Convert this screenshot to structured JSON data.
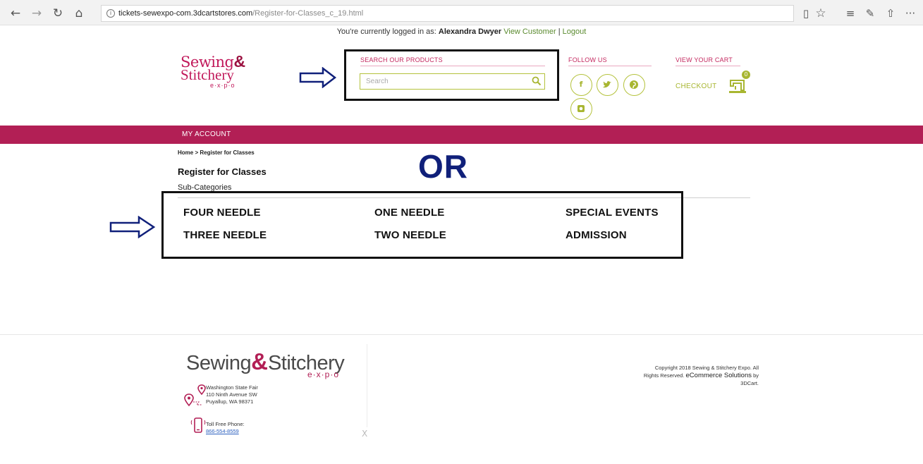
{
  "browser": {
    "url_domain": "tickets-sewexpo-com.3dcartstores.com",
    "url_path": "/Register-for-Classes_c_19.html",
    "info_symbol": "i",
    "back_glyph": "←",
    "forward_glyph": "→",
    "refresh_glyph": "↻",
    "home_glyph": "⌂",
    "reading_glyph": "▯",
    "favorite_glyph": "☆",
    "hub_glyph": "≡",
    "notes_glyph": "✎",
    "share_glyph": "⇧",
    "more_glyph": "···"
  },
  "login_bar": {
    "prefix": "You're currently logged in as:",
    "user": "Alexandra Dwyer",
    "view_customer": "View Customer",
    "separator": "|",
    "logout": "Logout"
  },
  "logo": {
    "line1": "Sewing",
    "amp": "&",
    "line2": "Stitchery",
    "line3": "e·x·p·o"
  },
  "search": {
    "label": "SEARCH OUR PRODUCTS",
    "placeholder": "Search"
  },
  "follow": {
    "label": "FOLLOW US",
    "facebook": "f",
    "twitter": "t"
  },
  "cart": {
    "label": "VIEW YOUR CART",
    "checkout": "CHECKOUT",
    "count": "0"
  },
  "nav": {
    "my_account": "MY ACCOUNT"
  },
  "main": {
    "breadcrumb_home": "Home",
    "breadcrumb_sep": ">",
    "breadcrumb_current": "Register for Classes",
    "title": "Register for Classes",
    "subcategories_label": "Sub-Categories",
    "or_text": "OR",
    "categories": [
      "FOUR NEEDLE",
      "ONE NEEDLE",
      "SPECIAL EVENTS",
      "THREE NEEDLE",
      "TWO NEEDLE",
      "ADMISSION"
    ]
  },
  "footer": {
    "logo_main1": "Sewing",
    "logo_amp": "&",
    "logo_main2": "Stitchery",
    "logo_sub": "e·x·p·o",
    "address_line1": "Washington State Fair",
    "address_line2": "110 Ninth Avenue SW",
    "address_line3": "Puyallup, WA 98371",
    "phone_label": "Toll Free Phone:",
    "phone_number": "866-554-8559",
    "copyright_line1": "Copyright 2018 Sewing & Stitchery Expo. All",
    "copyright_line2a": "Rights Reserved.",
    "copyright_line2b": "eCommerce Solutions",
    "copyright_line2c": "by",
    "copyright_line3": "3DCart.",
    "close_glyph": "X"
  },
  "colors": {
    "brand_pink": "#b21f55",
    "accent_green": "#a8b631",
    "annotation_blue": "#10207a"
  }
}
